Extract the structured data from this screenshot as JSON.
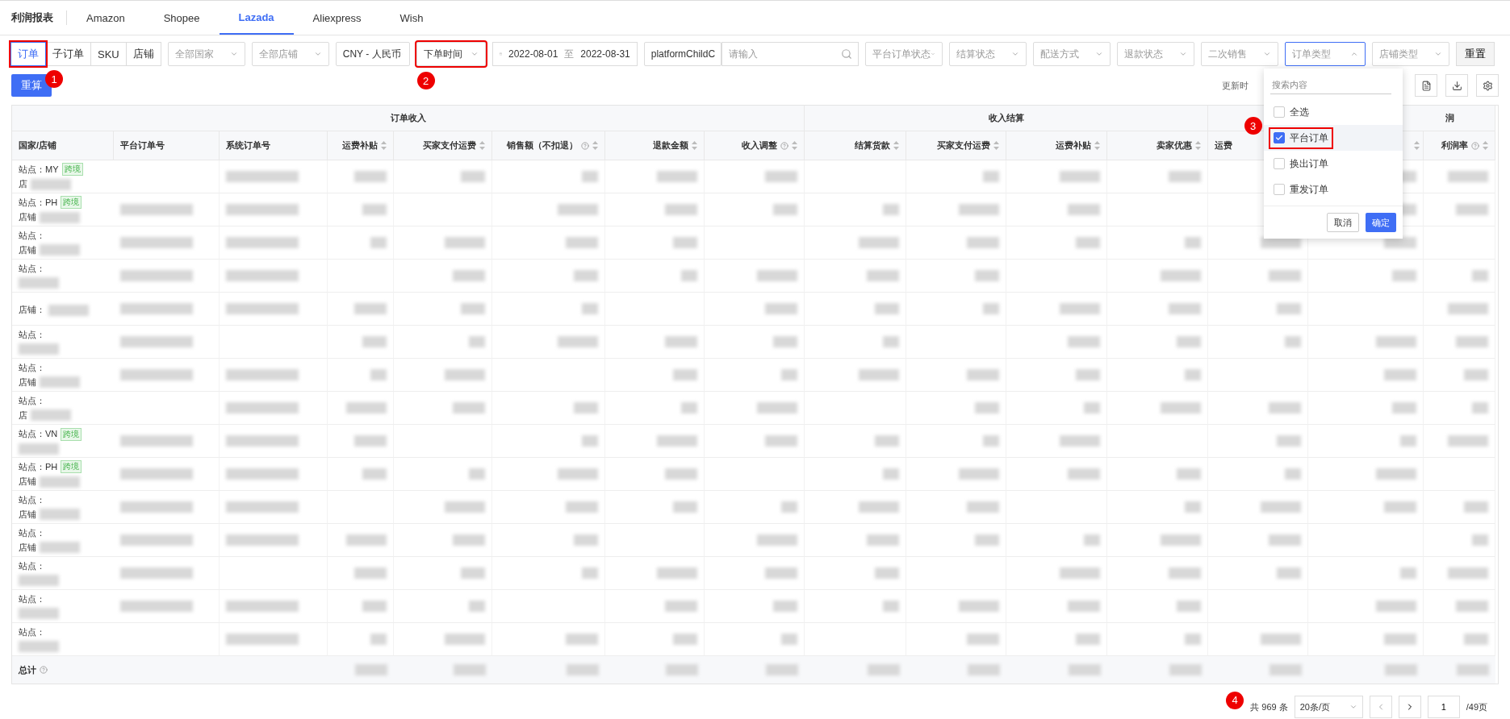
{
  "header": {
    "title": "利润报表"
  },
  "platform_tabs": [
    {
      "label": "Amazon",
      "selected": false
    },
    {
      "label": "Shopee",
      "selected": false
    },
    {
      "label": "Lazada",
      "selected": true
    },
    {
      "label": "Aliexpress",
      "selected": false
    },
    {
      "label": "Wish",
      "selected": false
    }
  ],
  "view_switch": [
    {
      "label": "订单",
      "selected": true,
      "marker": "1"
    },
    {
      "label": "子订单",
      "selected": false
    },
    {
      "label": "SKU",
      "selected": false
    },
    {
      "label": "店铺",
      "selected": false
    }
  ],
  "filters": [
    {
      "kind": "select",
      "placeholder": "全部国家"
    },
    {
      "kind": "select",
      "placeholder": "全部店铺"
    },
    {
      "kind": "select",
      "value": "CNY - 人民币"
    },
    {
      "kind": "select",
      "value": "下单时间",
      "marker": "2"
    },
    {
      "kind": "daterange",
      "start": "2022-08-01",
      "separator": "至",
      "end": "2022-08-31"
    },
    {
      "kind": "select",
      "value": "platformChildC"
    },
    {
      "kind": "search",
      "placeholder": "请输入"
    },
    {
      "kind": "select",
      "placeholder": "平台订单状态"
    },
    {
      "kind": "select",
      "placeholder": "结算状态"
    },
    {
      "kind": "select",
      "placeholder": "配送方式"
    },
    {
      "kind": "select",
      "placeholder": "退款状态"
    },
    {
      "kind": "select",
      "placeholder": "二次销售"
    },
    {
      "kind": "select",
      "placeholder": "订单类型",
      "expanded": true
    },
    {
      "kind": "select",
      "placeholder": "店铺类型"
    }
  ],
  "reset_button": "重置",
  "recalc_button": "重算",
  "update_label": "更新时",
  "dropdown": {
    "search_placeholder": "搜索内容",
    "options": [
      {
        "label": "全选",
        "checked": false,
        "selected": false
      },
      {
        "label": "平台订单",
        "checked": true,
        "selected": true,
        "marker": "3"
      },
      {
        "label": "换出订单",
        "checked": false,
        "selected": false
      },
      {
        "label": "重发订单",
        "checked": false,
        "selected": false
      }
    ],
    "cancel": "取消",
    "confirm": "确定"
  },
  "table": {
    "groups": [
      {
        "label": "订单收入"
      },
      {
        "label": "收入结算"
      },
      {
        "label": "润"
      }
    ],
    "columns": [
      {
        "label": "国家/店铺",
        "sortable": false,
        "help": false
      },
      {
        "label": "平台订单号",
        "sortable": false,
        "help": false
      },
      {
        "label": "系统订单号",
        "sortable": false,
        "help": false
      },
      {
        "label": "运费补贴",
        "sortable": true,
        "help": false
      },
      {
        "label": "买家支付运费",
        "sortable": true,
        "help": false
      },
      {
        "label": "销售额（不扣退）",
        "sortable": true,
        "help": true
      },
      {
        "label": "退款金额",
        "sortable": true,
        "help": false
      },
      {
        "label": "收入调整",
        "sortable": true,
        "help": true
      },
      {
        "label": "结算货款",
        "sortable": true,
        "help": false
      },
      {
        "label": "买家支付运费",
        "sortable": true,
        "help": false
      },
      {
        "label": "运费补贴",
        "sortable": true,
        "help": false
      },
      {
        "label": "卖家优惠",
        "sortable": true,
        "help": false
      },
      {
        "label": "运费",
        "sortable": false,
        "help": false
      },
      {
        "sortable": true,
        "help": false
      },
      {
        "label": "利润率",
        "sortable": true,
        "help": true
      }
    ],
    "rows": [
      {
        "site": "站点：MY",
        "tag": "跨境",
        "shop": "店"
      },
      {
        "site": "站点：PH",
        "tag": "跨境",
        "shop": "店铺"
      },
      {
        "site": "站点：",
        "shop": "店铺"
      },
      {
        "site": "站点："
      },
      {
        "shop": "店铺："
      },
      {
        "site": "站点："
      },
      {
        "site": "站点：",
        "shop": "店铺"
      },
      {
        "site": "站点：",
        "shop": "店"
      },
      {
        "site": "站点：VN",
        "tag": "跨境"
      },
      {
        "site": "站点：PH",
        "tag": "跨境",
        "shop": "店铺"
      },
      {
        "site": "站点：",
        "shop": "店铺"
      },
      {
        "site": "站点：",
        "shop": "店铺"
      },
      {
        "site": "站点："
      },
      {
        "site": "站点："
      },
      {
        "site": "站点："
      }
    ],
    "total_label": "总计"
  },
  "pagination": {
    "total": "共 969 条",
    "page_size": "20条/页",
    "page": "1",
    "pages": "/49页",
    "marker": "4"
  }
}
